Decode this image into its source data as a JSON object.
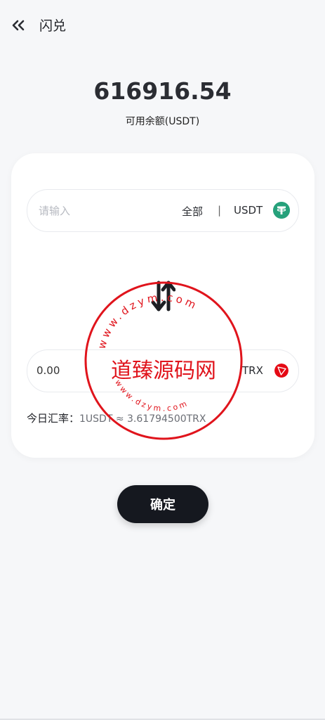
{
  "header": {
    "title": "闪兑",
    "back_icon": "double-chevron-left-icon"
  },
  "balance": {
    "amount": "616916.54",
    "label": "可用余额(USDT)"
  },
  "from": {
    "placeholder": "请输入",
    "value": "",
    "all_label": "全部",
    "divider": "|",
    "coin": "USDT",
    "coin_icon": "usdt-icon"
  },
  "swap_icon": "swap-arrows-icon",
  "to": {
    "value": "0.00",
    "coin": "TRX",
    "coin_icon": "tron-icon"
  },
  "rate": {
    "label": "今日汇率：",
    "value": "1USDT ≈ 3.61794500TRX"
  },
  "confirm_label": "确定",
  "watermark": {
    "text": "道臻源码网",
    "ring_text": "www.dzym.com",
    "color": "#e0141c"
  },
  "colors": {
    "background": "#f6f7f9",
    "card": "#ffffff",
    "button": "#15181f",
    "usdt": "#26a17b",
    "tron": "#e50914"
  }
}
